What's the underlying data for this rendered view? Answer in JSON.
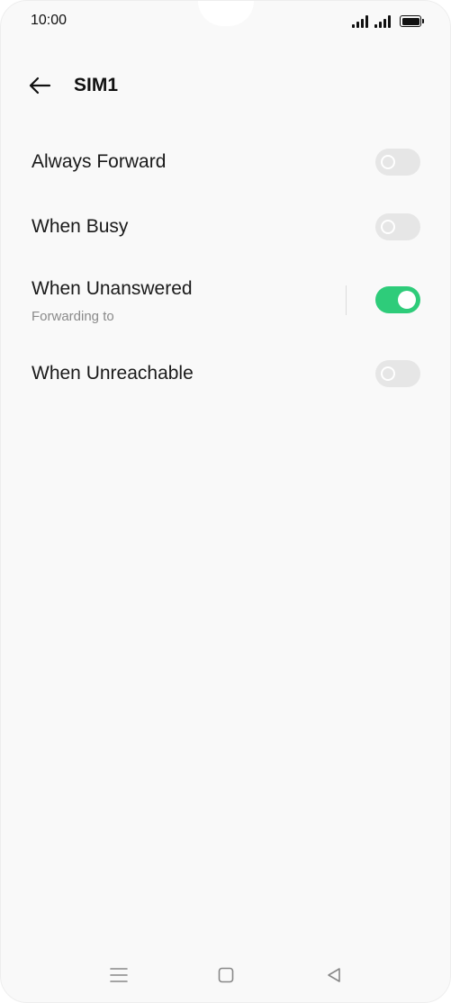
{
  "status_bar": {
    "time": "10:00",
    "icons": [
      "signal-icon",
      "signal-icon",
      "battery-icon"
    ]
  },
  "header": {
    "title": "SIM1",
    "back_icon": "arrow-left-icon"
  },
  "forwarding_options": [
    {
      "label": "Always Forward",
      "subtitle": "",
      "enabled": false
    },
    {
      "label": "When Busy",
      "subtitle": "",
      "enabled": false
    },
    {
      "label": "When Unanswered",
      "subtitle": "Forwarding to",
      "enabled": true
    },
    {
      "label": "When Unreachable",
      "subtitle": "",
      "enabled": false
    }
  ],
  "colors": {
    "accent": "#2ecc7a",
    "toggle_off": "#e6e6e6",
    "background": "#f9f9f9"
  },
  "nav_bar": {
    "icons": [
      "menu-icon",
      "home-icon",
      "back-triangle-icon"
    ]
  }
}
